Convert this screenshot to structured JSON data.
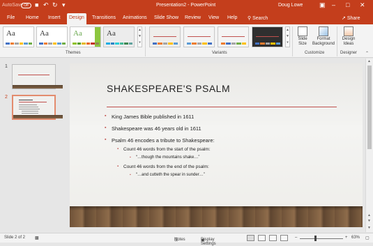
{
  "titlebar": {
    "autosave_label": "AutoSave",
    "autosave_state": "Off",
    "doc_title": "Presentation2 - PowerPoint",
    "user": "Doug Lowe"
  },
  "tabs": [
    "File",
    "Home",
    "Insert",
    "Design",
    "Transitions",
    "Animations",
    "Slide Show",
    "Review",
    "View",
    "Help"
  ],
  "active_tab": "Design",
  "tell_me": "Search",
  "share_label": "Share",
  "ribbon": {
    "themes_label": "Themes",
    "variants_label": "Variants",
    "customize_label": "Customize",
    "designer_label": "Designer",
    "slide_size": "Slide Size",
    "format_background": "Format Background",
    "design_ideas": "Design Ideas",
    "theme_glyph": "Aa"
  },
  "thumbnails": [
    {
      "number": "1"
    },
    {
      "number": "2"
    }
  ],
  "slide": {
    "title": "SHAKESPEARE'S PSALM",
    "bullets": [
      {
        "level": 1,
        "text": "King James Bible published in 1611"
      },
      {
        "level": 1,
        "text": "Shakespeare was 46 years old in 1611"
      },
      {
        "level": 1,
        "text": "Psalm 46 encodes a tribute to Shakespeare:"
      },
      {
        "level": 2,
        "text": "Count 46 words from the start of the psalm:"
      },
      {
        "level": 3,
        "text": "“…though the mountains shake…”"
      },
      {
        "level": 2,
        "text": "Count 46 words from the end of the psalm:"
      },
      {
        "level": 3,
        "text": "“…and cutteth the spear in sunder…”"
      }
    ]
  },
  "status": {
    "slide_info": "Slide 2 of 2",
    "notes": "Notes",
    "display_settings": "Display Settings",
    "zoom": "63%"
  },
  "colors": {
    "accent": "#c43e1c",
    "rule": "#c0504d"
  }
}
